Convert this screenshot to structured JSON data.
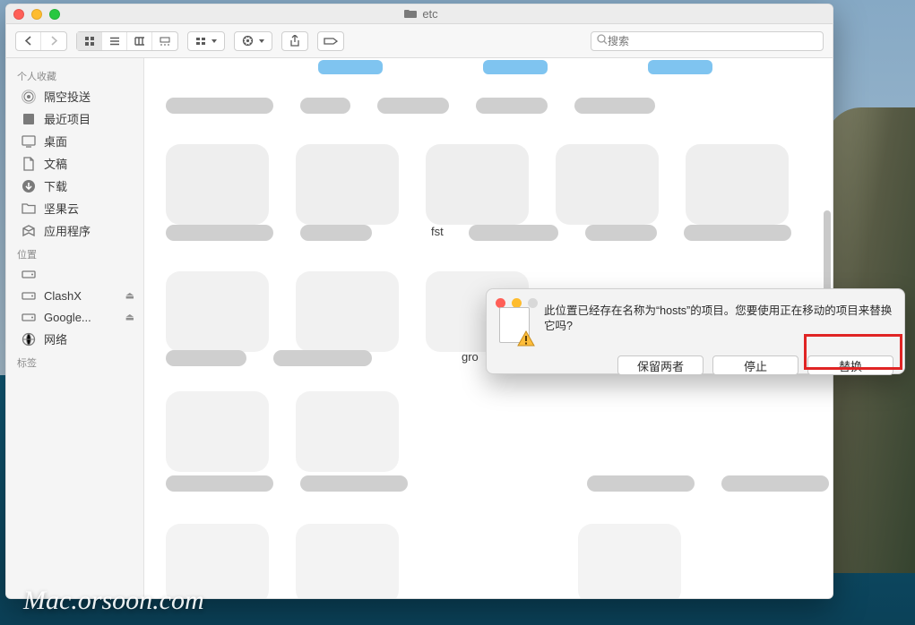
{
  "window_title": "etc",
  "search": {
    "placeholder": "搜索"
  },
  "sidebar": {
    "favorites_header": "个人收藏",
    "favorites": [
      {
        "icon": "airdrop",
        "label": "隔空投送"
      },
      {
        "icon": "recents",
        "label": "最近项目"
      },
      {
        "icon": "desktop",
        "label": "桌面"
      },
      {
        "icon": "documents",
        "label": "文稿"
      },
      {
        "icon": "downloads",
        "label": "下载"
      },
      {
        "icon": "folder",
        "label": "坚果云"
      },
      {
        "icon": "apps",
        "label": "应用程序"
      }
    ],
    "locations_header": "位置",
    "locations": [
      {
        "icon": "disk",
        "label": "",
        "obscured": true,
        "eject": false
      },
      {
        "icon": "disk",
        "label": "ClashX",
        "eject": true
      },
      {
        "icon": "disk",
        "label": "Google...",
        "eject": true
      },
      {
        "icon": "network",
        "label": "网络",
        "eject": false
      }
    ],
    "tags_header": "标签"
  },
  "content": {
    "visible_filenames": [
      "fst",
      "gro"
    ]
  },
  "dialog": {
    "message": "此位置已经存在名称为“hosts”的项目。您要使用正在移动的项目来替换它吗?",
    "keep_both_label": "保留两者",
    "stop_label": "停止",
    "replace_label": "替换"
  },
  "watermark": "Mac.orsoon.com"
}
